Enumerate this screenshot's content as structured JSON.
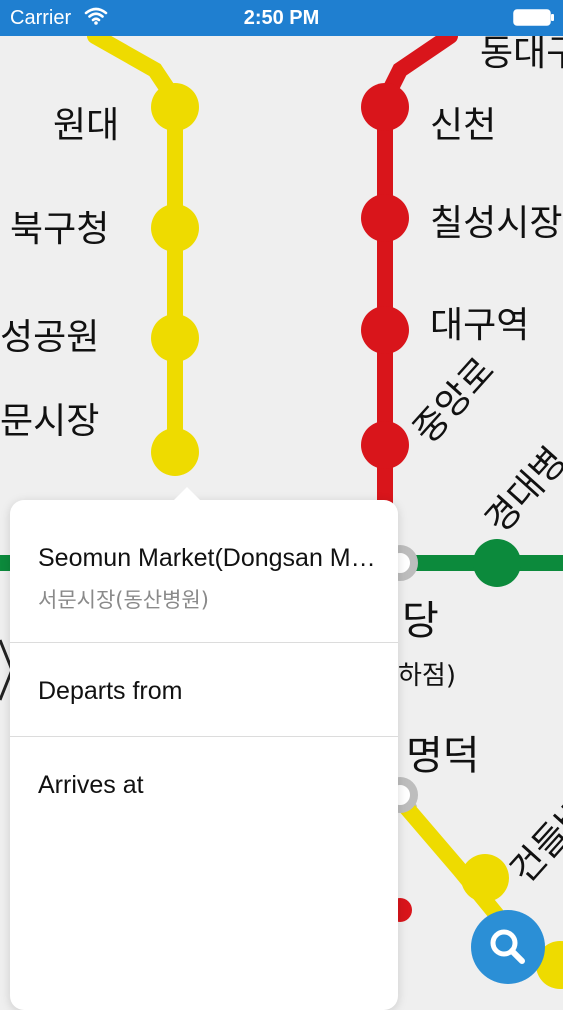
{
  "status_bar": {
    "carrier": "Carrier",
    "time": "2:50 PM"
  },
  "map": {
    "line_colors": {
      "line1_red": "#d9151b",
      "line2_green": "#0c8a3c",
      "line3_yellow": "#eedb00"
    },
    "stations": {
      "dongdaegu": "동대구",
      "wondae": "원대",
      "sincheon": "신천",
      "bukgucheong": "북구청",
      "chilseong_market": "칠성시장",
      "dalseong_park": "성공원",
      "daegu_station": "대구역",
      "seomun_market": "문시장",
      "jungangno": "중앙로",
      "kyungpook_hospital": "경대병",
      "banwoldang": "당",
      "banwoldang_sub": "하점)",
      "myeongdeok": "명덕",
      "geondeulbawi": "건들바"
    }
  },
  "popover": {
    "station_name": "Seomun Market(Dongsan Medical Center)",
    "station_name_korean": "서문시장(동산병원)",
    "departs_label": "Departs from",
    "arrives_label": "Arrives at"
  },
  "icons": {
    "wifi": "wifi-icon",
    "battery": "battery-icon",
    "search": "search-icon"
  },
  "accent_color": "#2b8fd6"
}
